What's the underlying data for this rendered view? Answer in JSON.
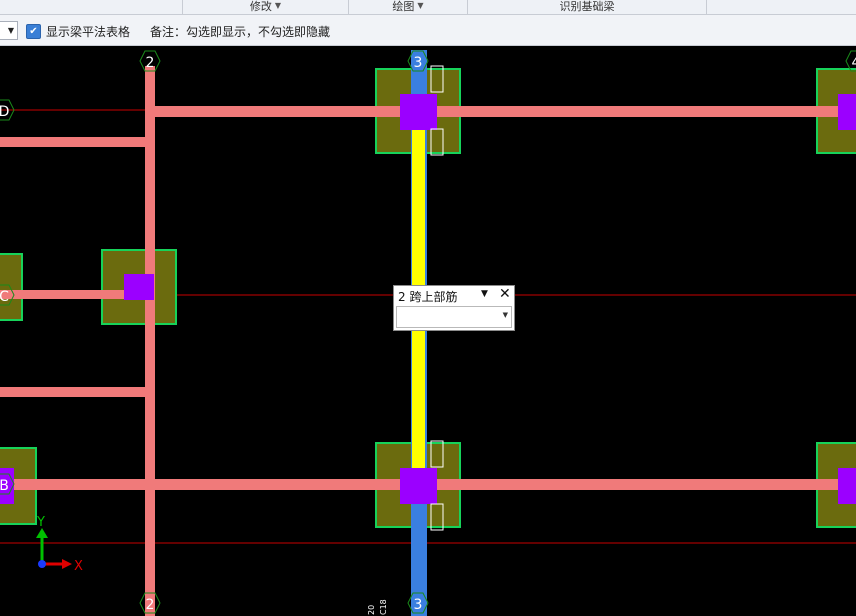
{
  "ribbon": {
    "groups": [
      {
        "label": "",
        "has_arrow": false
      },
      {
        "label": "修改",
        "has_arrow": true
      },
      {
        "label": "绘图",
        "has_arrow": true
      },
      {
        "label": "识别基础梁",
        "has_arrow": false
      }
    ]
  },
  "toolbar": {
    "show_table_label": "显示梁平法表格",
    "show_table_checked": true,
    "note": "备注：勾选即显示，不勾选即隐藏"
  },
  "grid": {
    "columns": [
      "2",
      "3",
      "4"
    ],
    "rows": [
      "D",
      "C",
      "B"
    ]
  },
  "popup": {
    "title": "2 跨上部筋",
    "select_value": ""
  },
  "axis": {
    "y_label": "Y",
    "x_label": "X"
  },
  "bottom_texts": [
    "20",
    "C18"
  ],
  "colors": {
    "background": "#000000",
    "beam": "#f07a7a",
    "selected_beam": "#ffff00",
    "column": "#9b00ff",
    "footing": "#6b6b0e",
    "footing_border": "#17d35a",
    "axis_line": "#d00000"
  }
}
